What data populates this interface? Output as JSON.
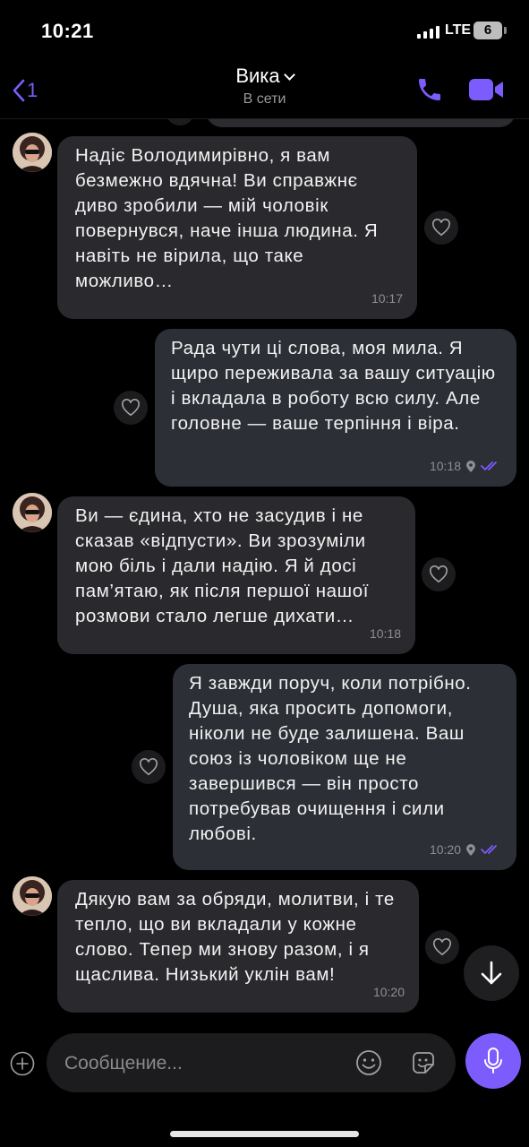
{
  "status_bar": {
    "time": "10:21",
    "network": "LTE",
    "battery": "6"
  },
  "header": {
    "back_count": "1",
    "contact_name": "Вика",
    "contact_status": "В сети"
  },
  "messages": [
    {
      "direction": "in",
      "text": "Надіє Володимирівно, я вам безмежно вдячна! Ви справжнє диво зробили — мій чоловік повернувся, наче інша людина. Я навіть не вірила, що таке можливо…",
      "time": "10:17"
    },
    {
      "direction": "out",
      "text": "Рада чути ці слова, моя мила. Я щиро переживала за вашу ситуацію і вкладала в роботу всю силу. Але головне — ваше терпіння і віра.",
      "time": "10:18"
    },
    {
      "direction": "in",
      "text": "Ви — єдина, хто не засудив і не сказав «відпусти». Ви зрозуміли мою біль і дали надію. Я й досі пам’ятаю, як після першої нашої розмови стало легше дихати…",
      "time": "10:18"
    },
    {
      "direction": "out",
      "text": "Я завжди поруч, коли потрібно. Душа, яка просить допомоги, ніколи не буде залишена. Ваш союз із чоловіком ще не завершився — він просто потребував очищення і сили любові.",
      "time": "10:20"
    },
    {
      "direction": "in",
      "text": "Дякую вам за обряди, молитви, і те тепло, що ви вкладали у кожне слово. Тепер ми знову разом, і я щаслива. Низький уклін вам!",
      "time": "10:20"
    }
  ],
  "composer": {
    "placeholder": "Сообщение..."
  },
  "colors": {
    "accent": "#7c5cfc",
    "bubble_in": "#2a2a2e",
    "bubble_out": "#2c2f36"
  },
  "icons": [
    "back-arrow-icon",
    "phone-icon",
    "video-camera-icon",
    "heart-icon",
    "location-icon",
    "double-check-icon",
    "arrow-down-icon",
    "plus-icon",
    "emoji-icon",
    "sticker-icon",
    "microphone-icon"
  ]
}
